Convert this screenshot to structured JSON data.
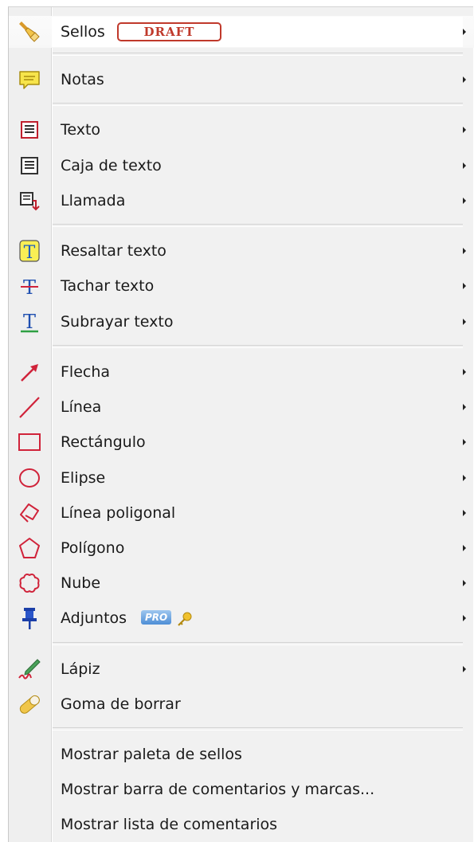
{
  "menu": {
    "items": [
      {
        "label": "Sellos",
        "icon": "stamp-icon",
        "badge": "DRAFT"
      },
      {
        "label": "Notas",
        "icon": "note-icon"
      },
      {
        "label": "Texto",
        "icon": "text-icon"
      },
      {
        "label": "Caja de texto",
        "icon": "text-box-icon"
      },
      {
        "label": "Llamada",
        "icon": "callout-icon"
      },
      {
        "label": "Resaltar texto",
        "icon": "highlight-text-icon"
      },
      {
        "label": "Tachar texto",
        "icon": "strikethrough-text-icon"
      },
      {
        "label": "Subrayar texto",
        "icon": "underline-text-icon"
      },
      {
        "label": "Flecha",
        "icon": "arrow-icon"
      },
      {
        "label": "Línea",
        "icon": "line-icon"
      },
      {
        "label": "Rectángulo",
        "icon": "rectangle-icon"
      },
      {
        "label": "Elipse",
        "icon": "ellipse-icon"
      },
      {
        "label": "Línea poligonal",
        "icon": "polyline-icon"
      },
      {
        "label": "Polígono",
        "icon": "polygon-icon"
      },
      {
        "label": "Nube",
        "icon": "cloud-icon"
      },
      {
        "label": "Adjuntos",
        "icon": "pin-icon",
        "badge": "PRO"
      },
      {
        "label": "Lápiz",
        "icon": "pencil-icon"
      },
      {
        "label": "Goma de borrar",
        "icon": "eraser-icon"
      },
      {
        "label": "Mostrar paleta de sellos"
      },
      {
        "label": "Mostrar barra de comentarios y marcas..."
      },
      {
        "label": "Mostrar lista de comentarios"
      }
    ]
  },
  "colors": {
    "draft_red": "#c0392b",
    "shape_red": "#d0233a",
    "menu_bg": "#f1f1f1"
  }
}
